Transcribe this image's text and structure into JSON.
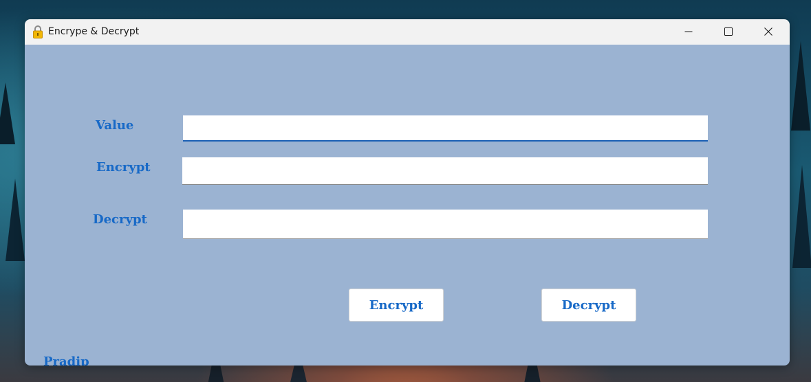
{
  "window": {
    "title": "Encrype & Decrypt",
    "app_icon": "lock-icon",
    "controls": [
      "minimize-icon",
      "maximize-icon",
      "close-icon"
    ]
  },
  "form": {
    "value_label": "Value",
    "encrypt_label": "Encrypt",
    "decrypt_label": "Decrypt",
    "value_field": "",
    "encrypt_field": "",
    "decrypt_field": ""
  },
  "buttons": {
    "encrypt": "Encrypt",
    "decrypt": "Decrypt"
  },
  "footer": {
    "author": "Pradip"
  },
  "colors": {
    "client_background": "#9bb3d2",
    "label_text": "#1769c7",
    "focus_underline": "#1a5fb4"
  }
}
